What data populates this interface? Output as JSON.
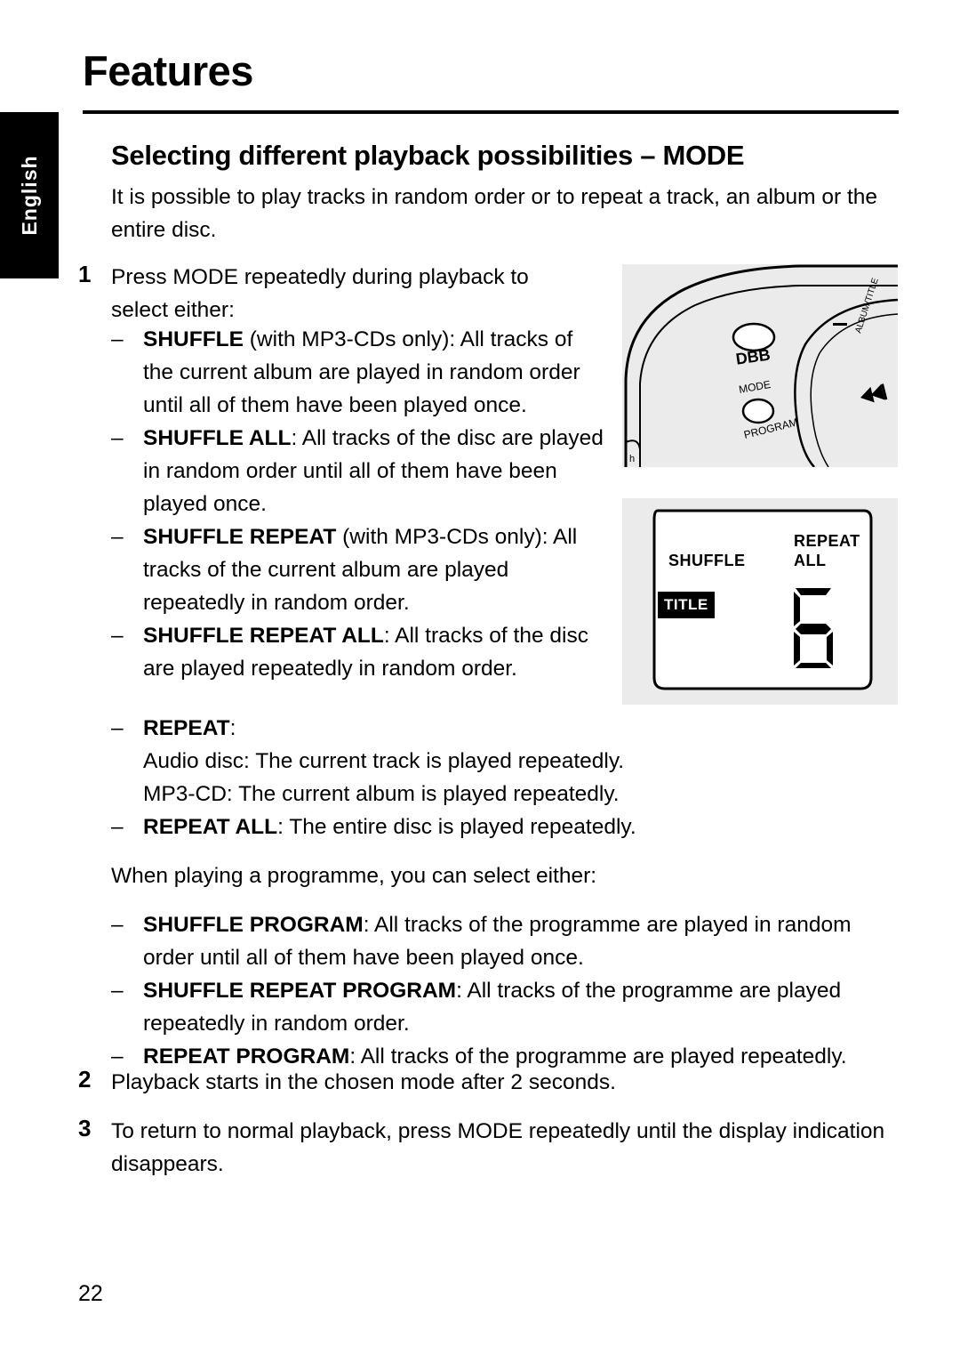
{
  "page": {
    "title": "Features",
    "section_title": "Selecting different playback possibilities – MODE",
    "side_tab": "English",
    "page_number": "22",
    "intro": "It is possible to play tracks in random order or to repeat a track, an album or the entire disc."
  },
  "steps": {
    "one": {
      "num": "1",
      "text": "Press MODE repeatedly during playback to select either:"
    },
    "two": {
      "num": "2",
      "text": "Playback starts in the chosen mode after 2 seconds."
    },
    "three": {
      "num": "3",
      "text": "To return to normal playback, press MODE repeatedly until the display indication disappears."
    }
  },
  "bullets_narrow": [
    {
      "dash": "–",
      "bold": "SHUFFLE",
      "rest": " (with MP3-CDs only): All tracks of the current album are played in random order until all of them have been played once."
    },
    {
      "dash": "–",
      "bold": "SHUFFLE ALL",
      "rest": ": All tracks of the disc are played in random order until all of them have been played once."
    },
    {
      "dash": "–",
      "bold": "SHUFFLE REPEAT",
      "rest": " (with MP3-CDs only): All tracks of the current album are played repeatedly in random order."
    },
    {
      "dash": "–",
      "bold": "SHUFFLE REPEAT ALL",
      "rest": ": All tracks of the disc are played repeatedly in random order."
    }
  ],
  "bullets_wide": [
    {
      "dash": "–",
      "bold": "REPEAT",
      "rest": ":"
    },
    {
      "dash": "",
      "bold": "",
      "rest": "Audio disc: The current track is played repeatedly."
    },
    {
      "dash": "",
      "bold": "",
      "rest": "MP3-CD: The current album is played repeatedly."
    },
    {
      "dash": "–",
      "bold": "REPEAT ALL",
      "rest": ": The entire disc is played repeatedly."
    }
  ],
  "mid_paragraph": "When playing a programme, you can select either:",
  "bullets_program": [
    {
      "dash": "–",
      "bold": "SHUFFLE PROGRAM",
      "rest": ": All tracks of the programme are played in random order until all of them have been played once."
    },
    {
      "dash": "–",
      "bold": "SHUFFLE REPEAT PROGRAM",
      "rest": ": All tracks of the programme are played repeatedly in random order."
    },
    {
      "dash": "–",
      "bold": "REPEAT PROGRAM",
      "rest": ": All tracks of the programme are played repeatedly."
    }
  ],
  "figure_player": {
    "labels": {
      "dbb": "DBB",
      "mode": "MODE",
      "program": "PROGRAM",
      "album_title": "ALBUM/TITLE"
    }
  },
  "figure_display": {
    "shuffle": "SHUFFLE",
    "repeat": "REPEAT",
    "all": "ALL",
    "title": "TITLE",
    "digit": "6"
  },
  "colors": {
    "background": "#ffffff",
    "text": "#000000",
    "figure_bg": "#ebebeb",
    "tab_bg": "#000000",
    "tab_text": "#ffffff"
  }
}
